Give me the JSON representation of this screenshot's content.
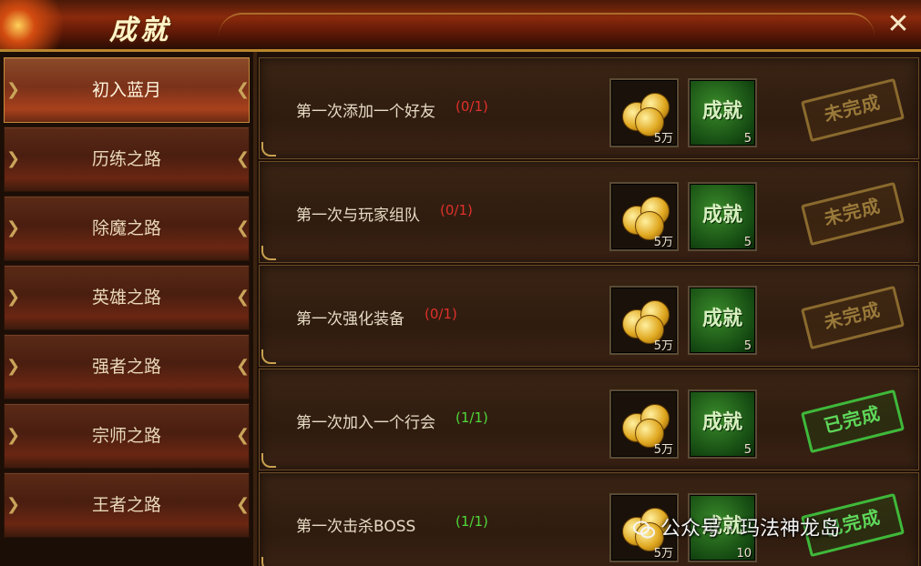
{
  "window": {
    "title": "成就",
    "close_icon": "✕"
  },
  "sidebar": {
    "tabs": [
      {
        "label": "初入蓝月",
        "active": true
      },
      {
        "label": "历练之路",
        "active": false
      },
      {
        "label": "除魔之路",
        "active": false
      },
      {
        "label": "英雄之路",
        "active": false
      },
      {
        "label": "强者之路",
        "active": false
      },
      {
        "label": "宗师之路",
        "active": false
      },
      {
        "label": "王者之路",
        "active": false
      }
    ]
  },
  "tasks": [
    {
      "name": "第一次添加一个好友",
      "progress": "(0/1)",
      "progress_color": "#e0302a",
      "reward_gold_qty": "5万",
      "reward_ach_label": "成就",
      "reward_ach_qty": "5",
      "status": "未完成",
      "completed": false
    },
    {
      "name": "第一次与玩家组队",
      "progress": "(0/1)",
      "progress_color": "#e0302a",
      "reward_gold_qty": "5万",
      "reward_ach_label": "成就",
      "reward_ach_qty": "5",
      "status": "未完成",
      "completed": false
    },
    {
      "name": "第一次强化装备",
      "progress": "(0/1)",
      "progress_color": "#e0302a",
      "reward_gold_qty": "5万",
      "reward_ach_label": "成就",
      "reward_ach_qty": "5",
      "status": "未完成",
      "completed": false
    },
    {
      "name": "第一次加入一个行会",
      "progress": "(1/1)",
      "progress_color": "#4ed83a",
      "reward_gold_qty": "5万",
      "reward_ach_label": "成就",
      "reward_ach_qty": "5",
      "status": "已完成",
      "completed": true
    },
    {
      "name": "第一次击杀BOSS",
      "progress": "(1/1)",
      "progress_color": "#4ed83a",
      "reward_gold_qty": "5万",
      "reward_ach_label": "成就",
      "reward_ach_qty": "10",
      "status": "已完成",
      "completed": true
    }
  ],
  "watermark": {
    "icon": "wechat-icon",
    "text": "公众号 · 玛法神龙岛"
  },
  "colors": {
    "accent_gold": "#c9993f",
    "incomplete": "#9a7a3a",
    "complete": "#5fd85a"
  }
}
